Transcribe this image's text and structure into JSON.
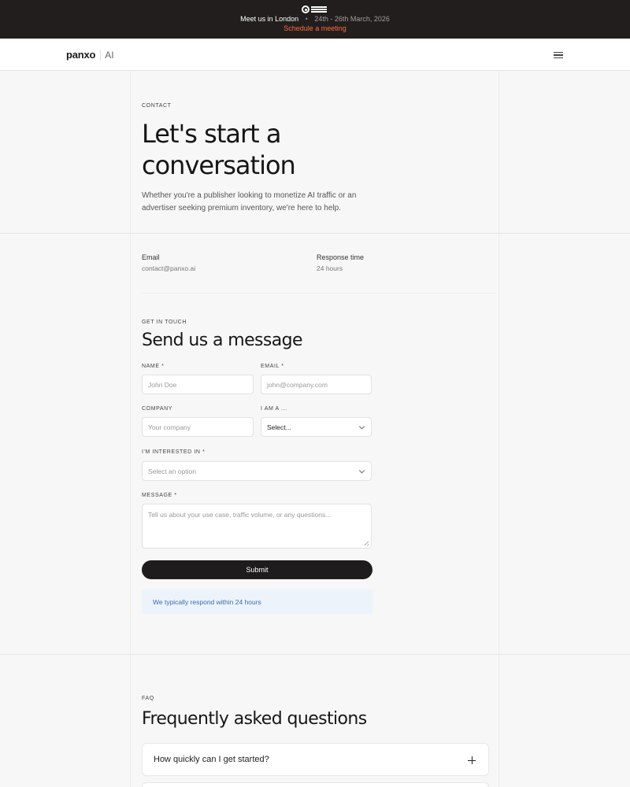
{
  "announcement": {
    "prefix": "Meet us in London",
    "separator": "•",
    "dates": "24th - 26th March, 2026",
    "cta": "Schedule a meeting",
    "logo_icon": "event-logo-icon"
  },
  "nav": {
    "brand": "panxo",
    "brand_suffix": "AI",
    "menu_icon": "hamburger-menu-icon"
  },
  "hero": {
    "eyebrow": "CONTACT",
    "title_line1": "Let's start a",
    "title_line2": "conversation",
    "description": "Whether you're a publisher looking to monetize AI traffic or an advertiser seeking premium inventory, we're here to help."
  },
  "contact_info": {
    "email_label": "Email",
    "email_value": "contact@panxo.ai",
    "response_label": "Response time",
    "response_value": "24 hours"
  },
  "form": {
    "eyebrow": "GET IN TOUCH",
    "title": "Send us a message",
    "name_label": "NAME *",
    "name_placeholder": "John Doe",
    "email_label": "EMAIL *",
    "email_placeholder": "john@company.com",
    "company_label": "COMPANY",
    "company_placeholder": "Your company",
    "role_label": "I AM A ...",
    "role_value": "Select...",
    "interest_label": "I'M INTERESTED IN *",
    "interest_value": "Select an option",
    "message_label": "MESSAGE *",
    "message_placeholder": "Tell us about your use case, traffic volume, or any questions...",
    "submit_label": "Submit",
    "notice": "We typically respond within 24 hours"
  },
  "faq": {
    "eyebrow": "FAQ",
    "title": "Frequently asked questions",
    "items": [
      {
        "question": "How quickly can I get started?"
      }
    ]
  },
  "colors": {
    "topbar_bg": "#221e1e",
    "accent": "#ff6a3d",
    "button_bg": "#1e1c1c",
    "notice_bg": "#edf3fb",
    "notice_text": "#3a6bb5"
  }
}
